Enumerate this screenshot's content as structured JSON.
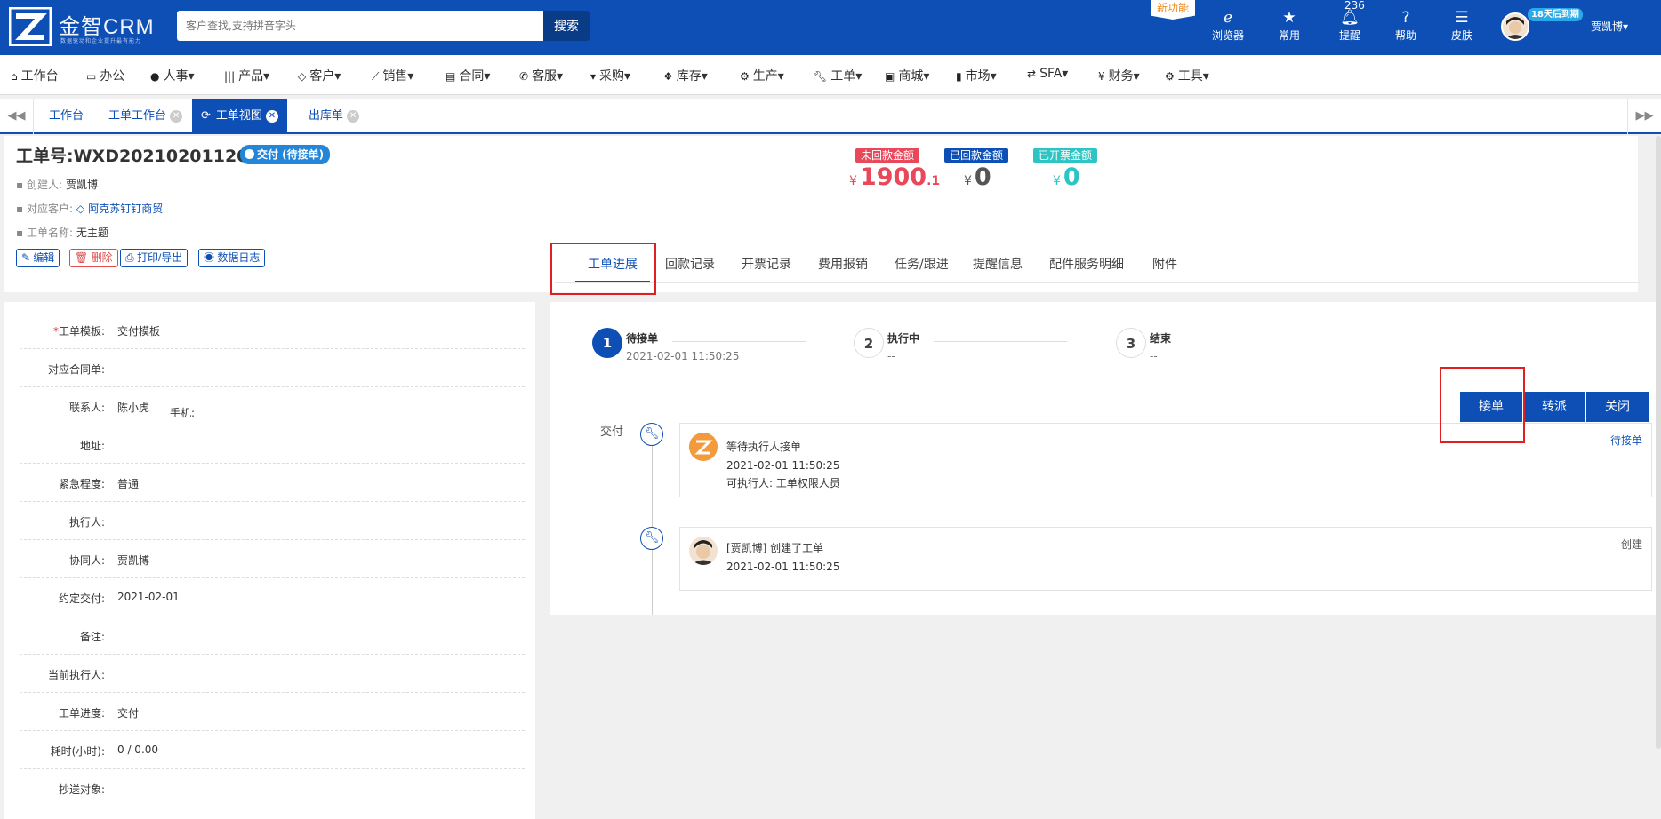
{
  "app": {
    "name": "金智CRM",
    "slogan": "数据驱动和企业提升最有能力"
  },
  "search": {
    "placeholder": "客户查找,支持拼音字头",
    "button": "搜索"
  },
  "header": {
    "new_feature": "新功能",
    "tools": [
      {
        "label": "浏览器",
        "icon": "ie-browser-icon"
      },
      {
        "label": "常用",
        "icon": "star-icon"
      },
      {
        "label": "提醒",
        "icon": "bell-icon"
      },
      {
        "label": "帮助",
        "icon": "help-icon"
      },
      {
        "label": "皮肤",
        "icon": "skin-icon"
      }
    ],
    "reminder_count": "236",
    "trial": "18天后到期",
    "username": "贾凯博▾"
  },
  "nav": [
    {
      "label": "工作台",
      "icon": "home-icon"
    },
    {
      "label": "办公",
      "icon": "laptop-icon"
    },
    {
      "label": "人事▾",
      "icon": "users-icon"
    },
    {
      "label": "产品▾",
      "icon": "barcode-icon"
    },
    {
      "label": "客户▾",
      "icon": "diamond-icon"
    },
    {
      "label": "销售▾",
      "icon": "chart-line-icon"
    },
    {
      "label": "合同▾",
      "icon": "contract-icon"
    },
    {
      "label": "客服▾",
      "icon": "phone-icon"
    },
    {
      "label": "采购▾",
      "icon": "cart-icon"
    },
    {
      "label": "库存▾",
      "icon": "cubes-icon"
    },
    {
      "label": "生产▾",
      "icon": "cogs-icon"
    },
    {
      "label": "工单▾",
      "icon": "wrench-icon"
    },
    {
      "label": "商城▾",
      "icon": "gift-icon"
    },
    {
      "label": "市场▾",
      "icon": "bookmark-icon"
    },
    {
      "label": "SFA▾",
      "icon": "retweet-icon"
    },
    {
      "label": "财务▾",
      "icon": "yen-icon"
    },
    {
      "label": "工具▾",
      "icon": "gear-icon"
    }
  ],
  "tabs": [
    {
      "label": "工作台"
    },
    {
      "label": "工单工作台"
    },
    {
      "label": "工单视图"
    },
    {
      "label": "出库单"
    }
  ],
  "workorder": {
    "title": "工单号:WXD2021020112002",
    "status": "交付 (待接单)",
    "creator_label": "创建人:",
    "creator": "贾凯博",
    "customer_label": "对应客户:",
    "customer": "阿克苏钉钉商贸",
    "name_label": "工单名称:",
    "name": "无主题"
  },
  "actions": [
    {
      "label": "编辑",
      "icon": "edit-icon"
    },
    {
      "label": "删除",
      "icon": "trash-icon"
    },
    {
      "label": "打印/导出",
      "icon": "print-icon"
    },
    {
      "label": "数据日志",
      "icon": "eye-icon"
    }
  ],
  "amounts": {
    "unpaid_label": "未回款金额",
    "unpaid_int": "1900",
    "unpaid_dec": ".1",
    "paid_label": "已回款金额",
    "paid": "0",
    "invoiced_label": "已开票金额",
    "invoiced": "0",
    "currency": "¥",
    "colors": {
      "unpaid": "#e8485a",
      "paid": "#0d4fb5",
      "invoiced": "#2ec4c4"
    }
  },
  "sub_tabs": [
    "工单进展",
    "回款记录",
    "开票记录",
    "费用报销",
    "任务/跟进",
    "提醒信息",
    "配件服务明细",
    "附件"
  ],
  "form": [
    {
      "label": "工单模板:",
      "value": "交付模板",
      "required": true
    },
    {
      "label": "对应合同单:",
      "value": ""
    },
    {
      "label": "联系人:",
      "value": "陈小虎",
      "extra": "手机:"
    },
    {
      "label": "地址:",
      "value": ""
    },
    {
      "label": "紧急程度:",
      "value": "普通"
    },
    {
      "label": "执行人:",
      "value": ""
    },
    {
      "label": "协同人:",
      "value": "贾凯博"
    },
    {
      "label": "约定交付:",
      "value": "2021-02-01"
    },
    {
      "label": "备注:",
      "value": ""
    },
    {
      "label": "当前执行人:",
      "value": ""
    },
    {
      "label": "工单进度:",
      "value": "交付"
    },
    {
      "label": "耗时(小时):",
      "value": "0 / 0.00"
    },
    {
      "label": "抄送对象:",
      "value": ""
    }
  ],
  "steps": [
    {
      "num": "1",
      "name": "待接单",
      "time": "2021-02-01 11:50:25"
    },
    {
      "num": "2",
      "name": "执行中",
      "time": "--"
    },
    {
      "num": "3",
      "name": "结束",
      "time": "--"
    }
  ],
  "buttons": {
    "accept": "接单",
    "transfer": "转派",
    "close": "关闭"
  },
  "timeline": {
    "stage": "交付",
    "events": [
      {
        "title": "等待执行人接单",
        "time": "2021-02-01 11:50:25",
        "detail": "可执行人:  工单权限人员",
        "tag": "待接单"
      },
      {
        "title": "[贾凯博] 创建了工单",
        "time": "2021-02-01 11:50:25",
        "tag": "创建"
      }
    ]
  }
}
